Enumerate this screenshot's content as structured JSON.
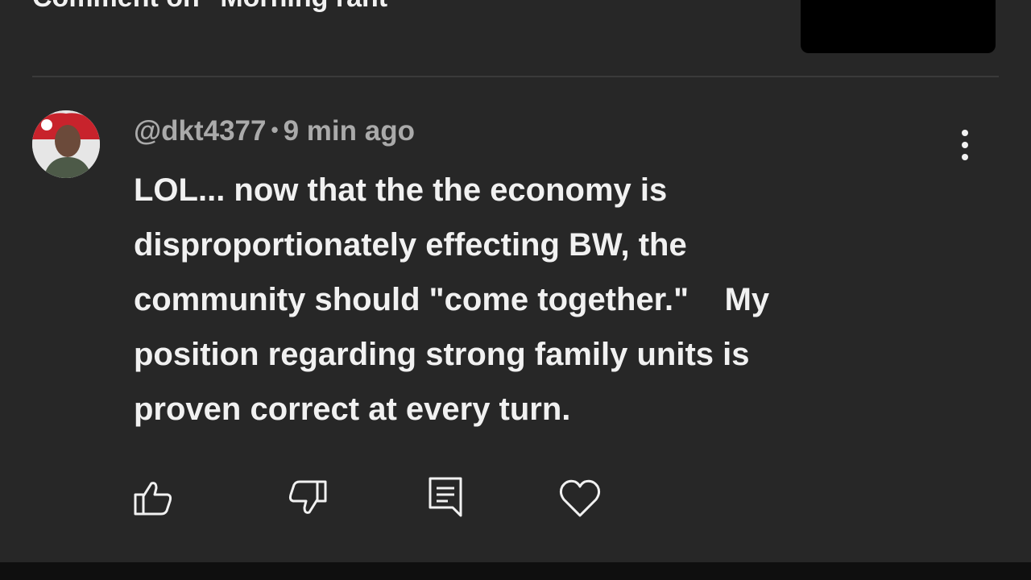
{
  "header": {
    "title": "Comment on \"Morning rant\""
  },
  "comment": {
    "author": "@dkt4377",
    "separator": "•",
    "time": "9 min ago",
    "text": "LOL... now that the the economy is\ndisproportionately effecting BW, the\ncommunity should \"come together.\"    My\nposition regarding strong family units is\nproven correct at every turn."
  },
  "icons": {
    "more": "more-vert-icon",
    "like": "thumbs-up-icon",
    "dislike": "thumbs-down-icon",
    "reply": "reply-comment-icon",
    "heart": "heart-icon"
  },
  "colors": {
    "background": "#272727",
    "text_primary": "#f1f1f1",
    "text_secondary": "#aaaaaa"
  }
}
